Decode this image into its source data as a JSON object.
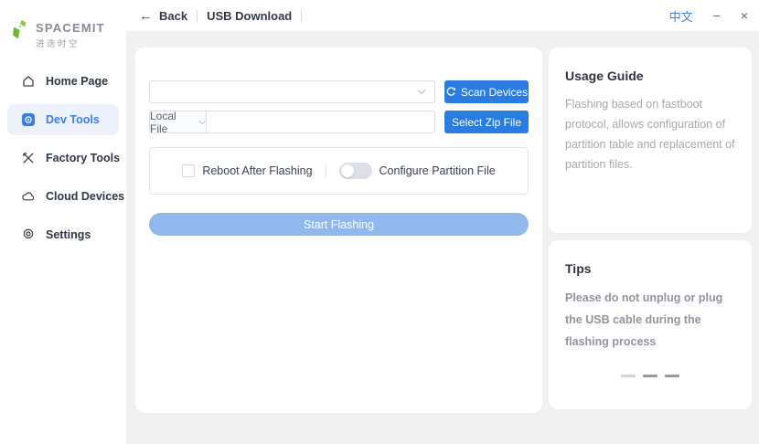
{
  "window": {
    "lang_button_label": "中文",
    "minimize_glyph": "−",
    "close_glyph": "×",
    "back_glyph": "←"
  },
  "topbar": {
    "back_label": "Back",
    "title": "USB Download"
  },
  "sidebar": {
    "logo_title": "SPACEMIT",
    "logo_subtitle": "进迭时空",
    "items": [
      {
        "label": "Home Page",
        "icon": "home-icon",
        "active": false
      },
      {
        "label": "Dev Tools",
        "icon": "dev-tools-icon",
        "active": true
      },
      {
        "label": "Factory Tools",
        "icon": "factory-tools-icon",
        "active": false
      },
      {
        "label": "Cloud Devices",
        "icon": "cloud-icon",
        "active": false
      },
      {
        "label": "Settings",
        "icon": "settings-icon",
        "active": false
      }
    ]
  },
  "main": {
    "device_select_value": "",
    "scan_button_label": "Scan Devices",
    "file_source_label": "Local File",
    "file_path_value": "",
    "select_zip_button_label": "Select Zip File",
    "reboot_checkbox_label": "Reboot After Flashing",
    "reboot_checkbox_checked": false,
    "partition_toggle_label": "Configure Partition File",
    "partition_toggle_on": false,
    "start_button_label": "Start Flashing",
    "start_button_enabled": false
  },
  "usage_guide": {
    "title": "Usage Guide",
    "body": "Flashing based on fastboot protocol, allows configuration of partition table and replacement of partition files."
  },
  "tips": {
    "title": "Tips",
    "body": "Please do not unplug or plug the USB cable during the flashing process",
    "carousel_dash_count": 3
  },
  "colors": {
    "primary_blue": "#2B7CE0",
    "start_disabled_blue": "#90B8EC",
    "active_menu_blue": "#3D7EE4",
    "active_menu_bg": "#ECF1FB",
    "brand_green": "#7DC242",
    "link_blue": "#4C7FD8",
    "content_bg": "#F1F1F2"
  }
}
